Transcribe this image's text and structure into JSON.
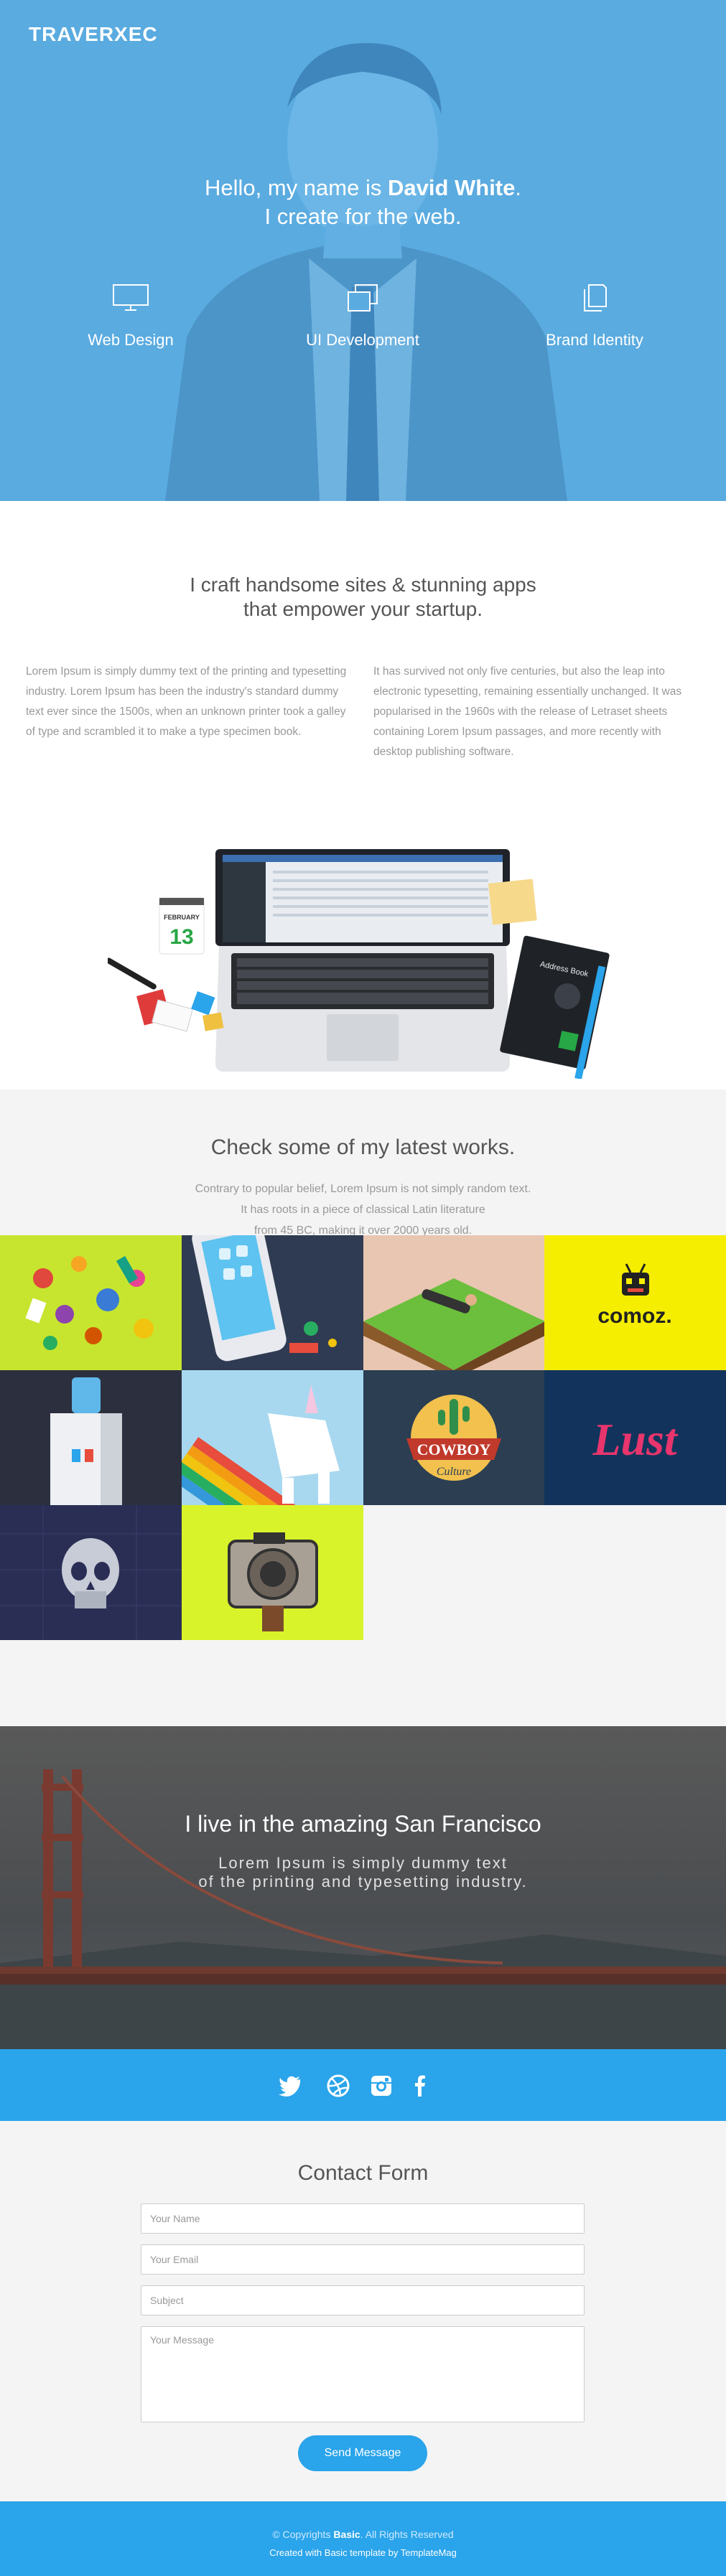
{
  "header": {
    "brand": "TRAVERXEC",
    "hello_prefix": "Hello, my name is ",
    "name": "David White",
    "hello_suffix": ".",
    "tagline": "I create for the web.",
    "services": [
      {
        "label": "Web Design",
        "icon": "monitor-icon"
      },
      {
        "label": "UI Development",
        "icon": "stacked-windows-icon"
      },
      {
        "label": "Brand Identity",
        "icon": "document-copy-icon"
      }
    ],
    "accent": "#5aabe0"
  },
  "intro": {
    "heading_line1": "I craft handsome sites & stunning apps",
    "heading_line2": "that empower your startup.",
    "col_left": "Lorem Ipsum is simply dummy text of the printing and typesetting industry. Lorem Ipsum has been the industry's standard dummy text ever since the 1500s, when an unknown printer took a galley of type and scrambled it to make a type specimen book.",
    "col_right": "It has survived not only five centuries, but also the leap into electronic typesetting, remaining essentially unchanged. It was popularised in the 1960s with the release of Letraset sheets containing Lorem Ipsum passages, and more recently with desktop publishing software.",
    "calendar_month": "FEBRUARY",
    "calendar_day": "13",
    "notebook_label": "Address Book"
  },
  "works": {
    "heading": "Check some of my latest works.",
    "line1": "Contrary to popular belief, Lorem Ipsum is not simply random text.",
    "line2": "It has roots in a piece of classical Latin literature",
    "line3": "from 45 BC, making it over 2000 years old.",
    "tiles": [
      {
        "name": "candy-illustration",
        "bg": "#c7e52e"
      },
      {
        "name": "iphone-illustration",
        "bg": "#2f3b52"
      },
      {
        "name": "hammock-illustration",
        "bg": "#e9c6b1"
      },
      {
        "name": "comoz-logo",
        "bg": "#f6ee00",
        "text": "comoz."
      },
      {
        "name": "water-cooler-illustration",
        "bg": "#2c2f3e"
      },
      {
        "name": "unicorn-illustration",
        "bg": "#a8d8ef"
      },
      {
        "name": "cowboy-culture-badge",
        "bg": "#2b3e52",
        "text1": "COWBOY",
        "text2": "Culture"
      },
      {
        "name": "lust-lettering",
        "bg": "#12345c",
        "text": "Lust"
      },
      {
        "name": "skull-illustration",
        "bg": "#2a2e55"
      },
      {
        "name": "camera-illustration",
        "bg": "#d9f32b"
      }
    ]
  },
  "city": {
    "heading": "I live in the amazing San Francisco",
    "line1": "Lorem Ipsum is simply dummy text",
    "line2": "of the printing and typesetting industry."
  },
  "social": {
    "icons": [
      "twitter-icon",
      "dribbble-icon",
      "instagram-icon",
      "facebook-icon"
    ],
    "bg": "#2aa4ea"
  },
  "contact": {
    "heading": "Contact Form",
    "name_placeholder": "Your Name",
    "email_placeholder": "Your Email",
    "subject_placeholder": "Subject",
    "message_placeholder": "Your Message",
    "send_label": "Send Message"
  },
  "footer": {
    "copy_prefix": "© Copyrights ",
    "copy_brand": "Basic",
    "copy_suffix": ". All Rights Reserved",
    "credit": "Created with Basic template by TemplateMag"
  }
}
